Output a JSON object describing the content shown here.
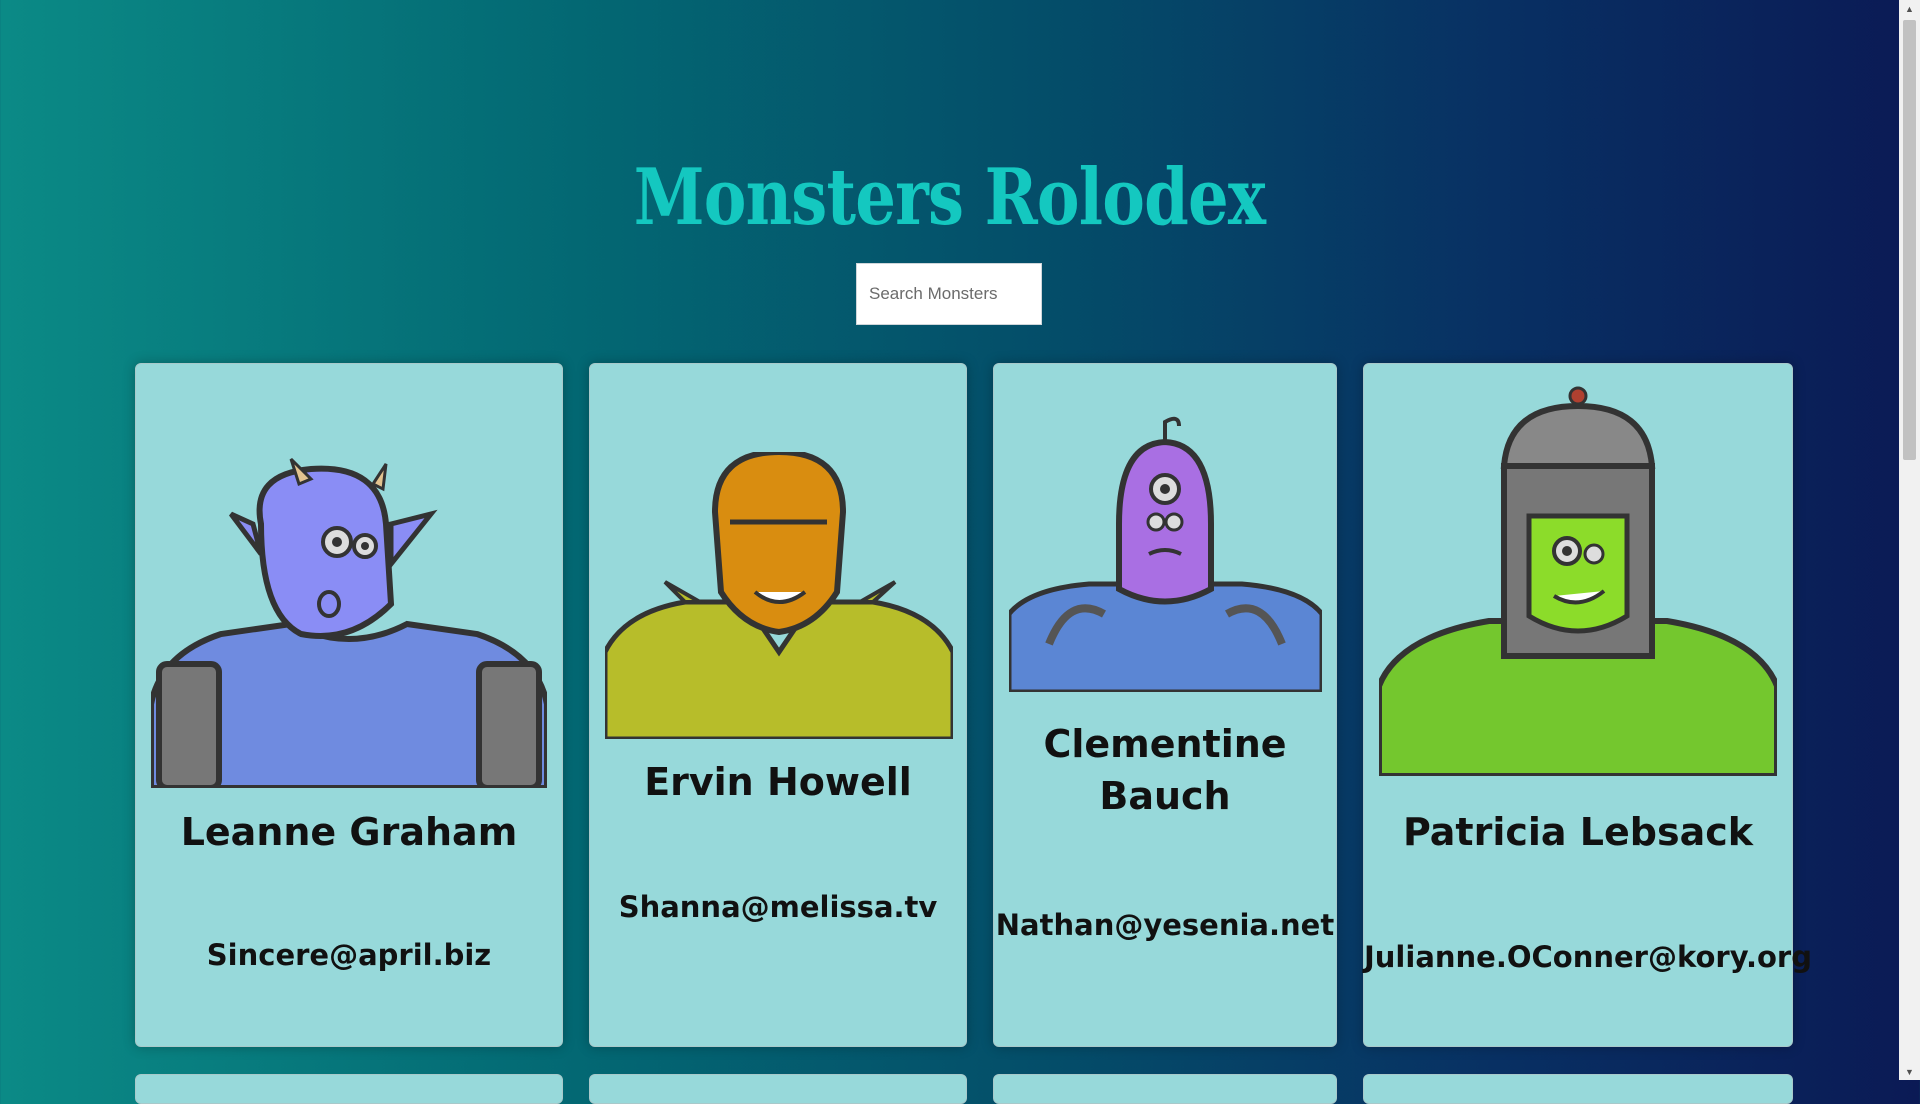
{
  "app": {
    "title": "Monsters Rolodex"
  },
  "search": {
    "placeholder": "Search Monsters",
    "value": ""
  },
  "monsters": [
    {
      "name": "Leanne Graham",
      "email": "Sincere@april.biz"
    },
    {
      "name": "Ervin Howell",
      "email": "Shanna@melissa.tv"
    },
    {
      "name": "Clementine Bauch",
      "email": "Nathan@yesenia.net"
    },
    {
      "name": "Patricia Lebsack",
      "email": "Julianne.OConner@kory.org"
    }
  ],
  "colors": {
    "title": "#14c8c0",
    "card_background": "#97d9da",
    "background_left": "#0b8a86",
    "background_right": "#0b1a55"
  },
  "icons": {
    "scroll_up": "▲",
    "scroll_down": "▼"
  }
}
